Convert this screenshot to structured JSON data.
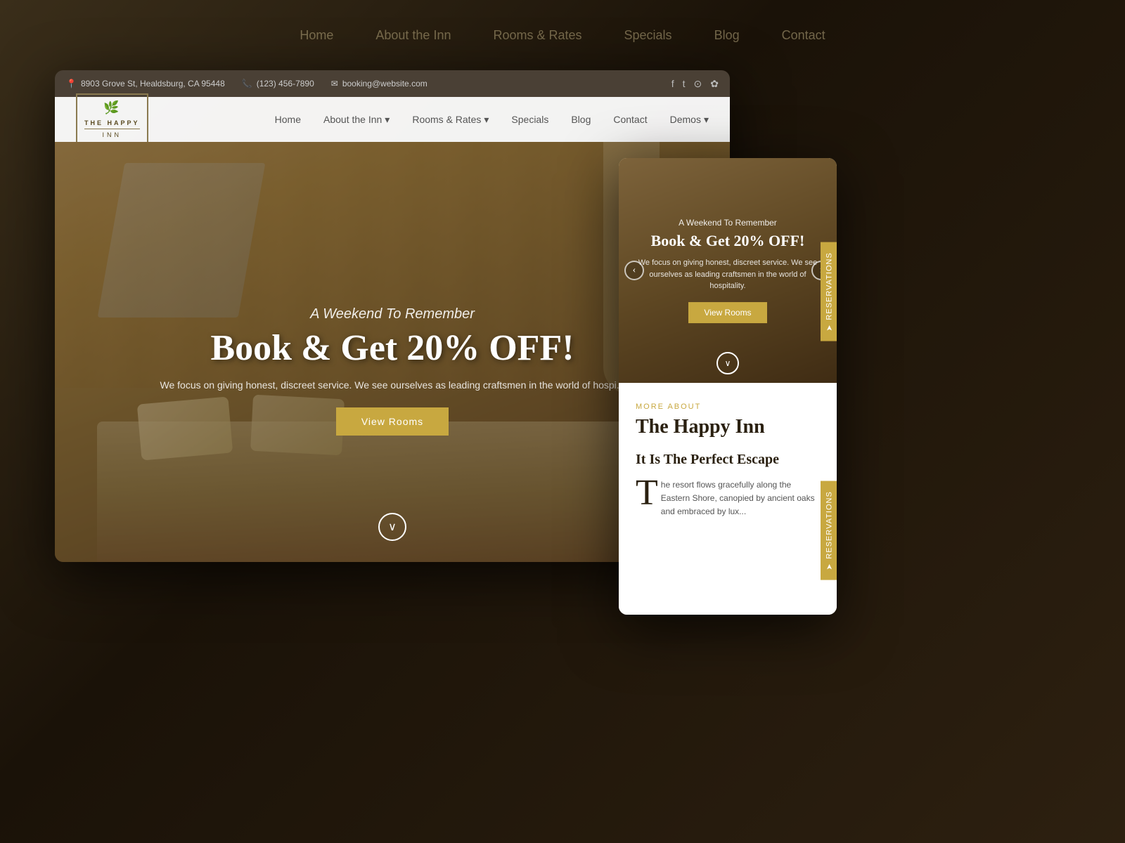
{
  "background": {
    "nav_items": [
      "Home",
      "About the Inn",
      "Rooms & Rates",
      "Specials",
      "Blog",
      "Contact"
    ]
  },
  "top_bar": {
    "address": "8903 Grove St, Healdsburg, CA 95448",
    "phone": "(123) 456-7890",
    "email": "booking@website.com",
    "social": [
      "f",
      "t",
      "camera",
      "yelp"
    ]
  },
  "nav": {
    "logo_line1": "THE HAPPY",
    "logo_line2": "INN",
    "links": [
      {
        "label": "Home",
        "has_dropdown": false
      },
      {
        "label": "About the Inn",
        "has_dropdown": true
      },
      {
        "label": "Rooms & Rates",
        "has_dropdown": true
      },
      {
        "label": "Specials",
        "has_dropdown": false
      },
      {
        "label": "Blog",
        "has_dropdown": false
      },
      {
        "label": "Contact",
        "has_dropdown": false
      },
      {
        "label": "Demos",
        "has_dropdown": true
      }
    ]
  },
  "hero": {
    "subtitle": "A Weekend To Remember",
    "title": "Book & Get 20% OFF!",
    "description": "We focus on giving honest, discreet service. We see ourselves as leading craftsmen in the world of hospi...",
    "button_label": "View Rooms",
    "scroll_icon": "∨"
  },
  "hero_mini": {
    "subtitle": "A Weekend To Remember",
    "title": "Book & Get 20% OFF!",
    "description": "We focus on giving honest, discreet service. We see ourselves as leading craftsmen in the world of hospitality.",
    "button_label": "View Rooms",
    "scroll_icon": "∨",
    "prev_arrow": "‹",
    "next_arrow": "›"
  },
  "reservations": {
    "label": "RESERVATIONS",
    "arrow": "➤"
  },
  "about": {
    "label": "MORE ABOUT",
    "title": "The Happy Inn",
    "subtitle": "It Is The Perfect Escape",
    "dropcap": "T",
    "text": "he resort flows gracefully along the Eastern Shore, canopied by ancient oaks and embraced by lux..."
  }
}
